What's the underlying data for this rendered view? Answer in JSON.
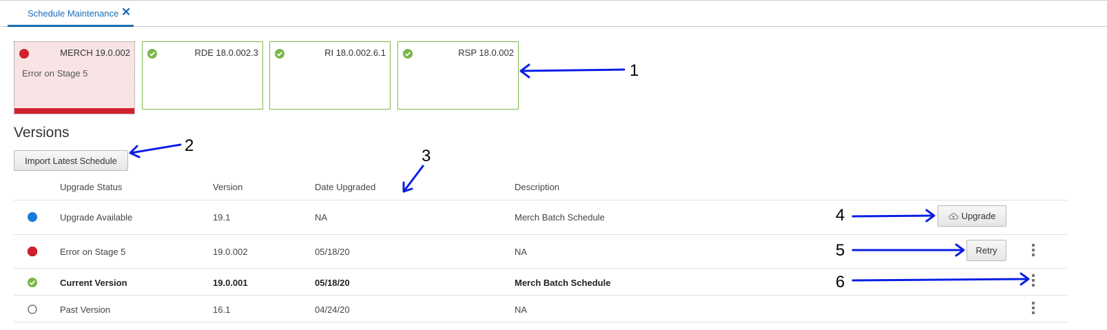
{
  "tab": {
    "label": "Schedule Maintenance",
    "close_glyph": "✕"
  },
  "cards": [
    {
      "name": "MERCH 19.0.002",
      "status": "error",
      "subtitle": "Error on Stage 5",
      "icon": "error-dot-icon"
    },
    {
      "name": "RDE 18.0.002.3",
      "status": "ok",
      "subtitle": "",
      "icon": "check-circle-icon"
    },
    {
      "name": "RI 18.0.002.6.1",
      "status": "ok",
      "subtitle": "",
      "icon": "check-circle-icon"
    },
    {
      "name": "RSP 18.0.002",
      "status": "ok",
      "subtitle": "",
      "icon": "check-circle-icon"
    }
  ],
  "versions": {
    "title": "Versions",
    "import_button": "Import Latest Schedule",
    "columns": [
      "Upgrade Status",
      "Version",
      "Date Upgraded",
      "Description"
    ],
    "rows": [
      {
        "status": "Upgrade Available",
        "version": "19.1",
        "date": "NA",
        "description": "Merch Batch Schedule",
        "icon": "blue-dot-icon",
        "action": "Upgrade",
        "action_icon": "cloud-upload-icon",
        "menu": false,
        "bold": false
      },
      {
        "status": "Error on Stage 5",
        "version": "19.0.002",
        "date": "05/18/20",
        "description": "NA",
        "icon": "error-octagon-icon",
        "action": "Retry",
        "menu": true,
        "bold": false
      },
      {
        "status": "Current Version",
        "version": "19.0.001",
        "date": "05/18/20",
        "description": "Merch Batch Schedule",
        "icon": "check-circle-icon",
        "action": "",
        "menu": true,
        "bold": true
      },
      {
        "status": "Past Version",
        "version": "16.1",
        "date": "04/24/20",
        "description": "NA",
        "icon": "empty-circle-icon",
        "action": "",
        "menu": true,
        "bold": false
      }
    ]
  },
  "callouts": [
    "1",
    "2",
    "3",
    "4",
    "5",
    "6"
  ],
  "colors": {
    "accent": "#1a6db5",
    "error": "#d0202e",
    "ok": "#7ab648",
    "callout_arrow": "#0a1ee6",
    "info": "#1a7ad8"
  }
}
